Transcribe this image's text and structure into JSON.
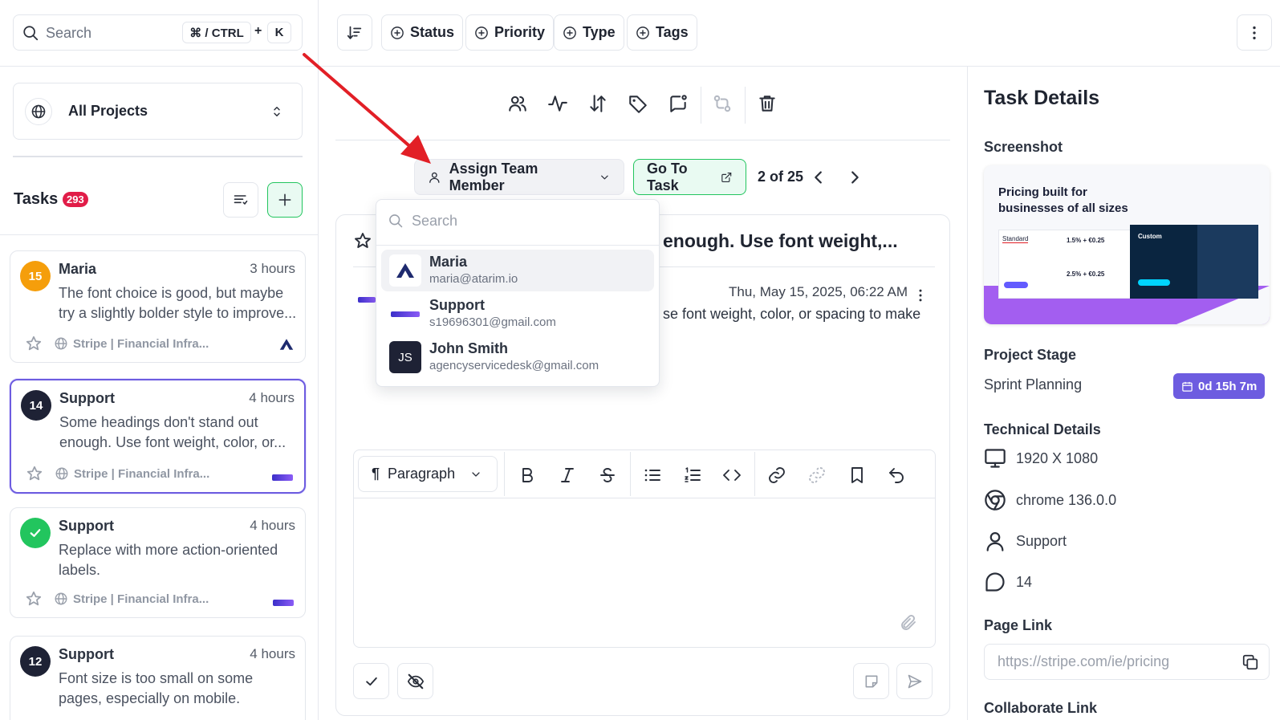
{
  "search": {
    "placeholder": "Search",
    "shortcut_mod": "⌘ / CTRL",
    "shortcut_plus": "+",
    "shortcut_key": "K"
  },
  "filters": [
    {
      "label": "Status"
    },
    {
      "label": "Priority"
    },
    {
      "label": "Type"
    },
    {
      "label": "Tags"
    }
  ],
  "project_selector": {
    "label": "All Projects"
  },
  "tasks": {
    "heading": "Tasks",
    "count": "293"
  },
  "task_cards": [
    {
      "badge": "15",
      "badge_color": "#f59e0b",
      "name": "Maria",
      "time": "3 hours",
      "text": "The font choice is good, but maybe try a slightly bolder style to improve...",
      "project": "Stripe | Financial Infra...",
      "selected": false
    },
    {
      "badge": "14",
      "badge_color": "#1e2235",
      "name": "Support",
      "time": "4 hours",
      "text": "Some headings don't stand out enough. Use font weight, color, or...",
      "project": "Stripe | Financial Infra...",
      "selected": true
    },
    {
      "badge": "",
      "badge_color": "#22c55e",
      "name": "Support",
      "time": "4 hours",
      "text": "Replace with more action-oriented labels.",
      "project": "Stripe | Financial Infra...",
      "selected": false
    },
    {
      "badge": "12",
      "badge_color": "#1e2235",
      "name": "Support",
      "time": "4 hours",
      "text": "Font size is too small on some pages, especially on mobile.",
      "project": "",
      "selected": false
    }
  ],
  "task_nav": {
    "assign_label": "Assign Team Member",
    "go_to_task_label": "Go To Task",
    "position": "2 of 25"
  },
  "assign_dropdown": {
    "search_placeholder": "Search",
    "members": [
      {
        "name": "Maria",
        "email": "maria@atarim.io",
        "avatar": "",
        "highlighted": true
      },
      {
        "name": "Support",
        "email": "s19696301@gmail.com",
        "avatar": "",
        "highlighted": false
      },
      {
        "name": "John Smith",
        "email": "agencyservicedesk@gmail.com",
        "avatar": "JS",
        "highlighted": false
      }
    ]
  },
  "task_view": {
    "title": "enough. Use font weight,...",
    "date": "Thu, May 15, 2025, 06:22 AM",
    "comment": "se font weight, color, or spacing to make"
  },
  "editor": {
    "block_type": "Paragraph"
  },
  "details": {
    "heading": "Task Details",
    "screenshot_label": "Screenshot",
    "screenshot": {
      "headline": "Pricing built for businesses of all sizes",
      "plan_standard": "Standard",
      "price_1": "1.5% + €0.25",
      "price_2": "2.5% + €0.25",
      "plan_custom": "Custom"
    },
    "stage_label": "Project Stage",
    "stage_value": "Sprint Planning",
    "stage_timer": "0d 15h 7m",
    "tech_label": "Technical Details",
    "resolution": "1920 X 1080",
    "browser": "chrome 136.0.0",
    "user": "Support",
    "task_number": "14",
    "page_link_label": "Page Link",
    "page_link": "https://stripe.com/ie/pricing",
    "collab_label": "Collaborate Link"
  },
  "colors": {
    "accent": "#6d5ce0",
    "green": "#22c55e",
    "count_badge": "#e11d48",
    "timer_bg": "#6d5ce0"
  }
}
